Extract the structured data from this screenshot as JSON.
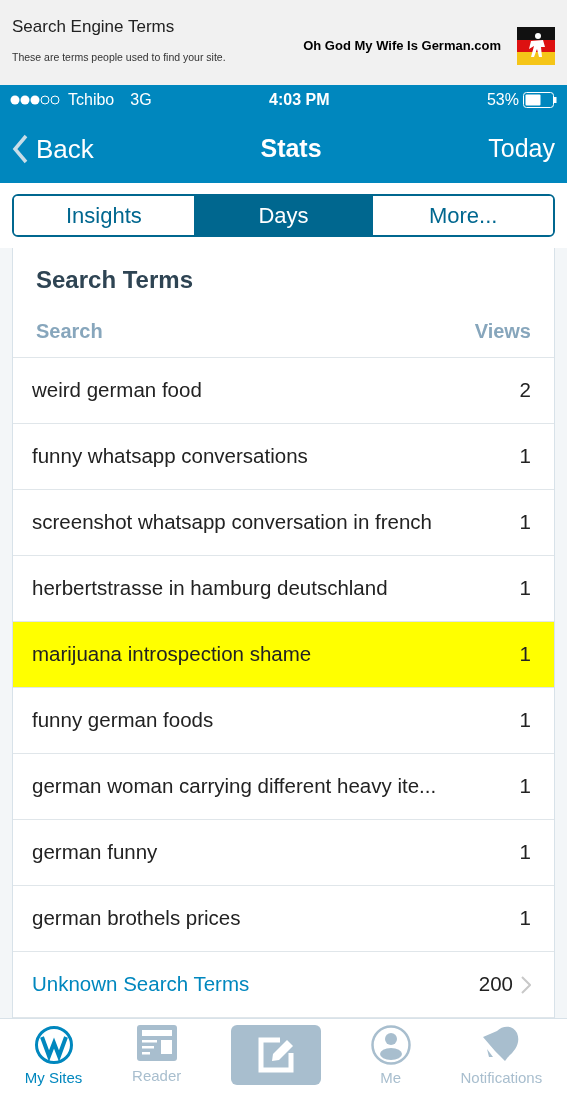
{
  "banner": {
    "title": "Search Engine Terms",
    "subtitle": "These are terms people used to find your site.",
    "site": "Oh God My Wife Is German.com"
  },
  "status_bar": {
    "carrier": "Tchibo",
    "network": "3G",
    "time": "4:03 PM",
    "battery": "53%"
  },
  "nav": {
    "back": "Back",
    "title": "Stats",
    "right": "Today"
  },
  "tabs": [
    {
      "label": "Insights",
      "selected": false
    },
    {
      "label": "Days",
      "selected": true
    },
    {
      "label": "More...",
      "selected": false
    }
  ],
  "card": {
    "title": "Search Terms",
    "columns": [
      "Search",
      "Views"
    ],
    "rows": [
      {
        "term": "weird german food",
        "views": "2",
        "highlighted": false
      },
      {
        "term": "funny whatsapp conversations",
        "views": "1",
        "highlighted": false
      },
      {
        "term": "screenshot whatsapp conversation in french",
        "views": "1",
        "highlighted": false
      },
      {
        "term": "herbertstrasse in hamburg deutschland",
        "views": "1",
        "highlighted": false
      },
      {
        "term": "marijuana introspection shame",
        "views": "1",
        "highlighted": true
      },
      {
        "term": "funny german foods",
        "views": "1",
        "highlighted": false
      },
      {
        "term": "german woman carrying different heavy ite...",
        "views": "1",
        "highlighted": false
      },
      {
        "term": "german funny",
        "views": "1",
        "highlighted": false
      },
      {
        "term": "german brothels prices",
        "views": "1",
        "highlighted": false
      }
    ],
    "footer": {
      "label": "Unknown Search Terms",
      "views": "200"
    }
  },
  "tab_bar": [
    {
      "kind": "sites",
      "label": "My Sites",
      "selected": true
    },
    {
      "kind": "reader",
      "label": "Reader",
      "selected": false
    },
    {
      "kind": "compose",
      "selected": false
    },
    {
      "kind": "me",
      "label": "Me",
      "selected": false
    },
    {
      "kind": "notifications",
      "label": "Notifications",
      "selected": false
    }
  ]
}
